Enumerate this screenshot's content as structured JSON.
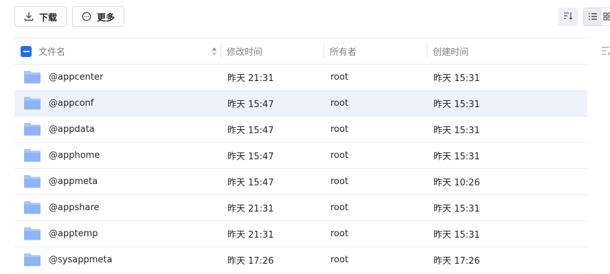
{
  "toolbar": {
    "download_label": "下载",
    "more_label": "更多"
  },
  "table": {
    "columns": {
      "name": "文件名",
      "modified": "修改时间",
      "owner": "所有者",
      "created": "创建时间"
    },
    "rows": [
      {
        "name": "@appcenter",
        "modified": "昨天 21:31",
        "owner": "root",
        "created": "昨天 15:31"
      },
      {
        "name": "@appconf",
        "modified": "昨天 15:47",
        "owner": "root",
        "created": "昨天 15:31"
      },
      {
        "name": "@appdata",
        "modified": "昨天 15:47",
        "owner": "root",
        "created": "昨天 15:31"
      },
      {
        "name": "@apphome",
        "modified": "昨天 15:47",
        "owner": "root",
        "created": "昨天 15:31"
      },
      {
        "name": "@appmeta",
        "modified": "昨天 15:47",
        "owner": "root",
        "created": "昨天 10:26"
      },
      {
        "name": "@appshare",
        "modified": "昨天 21:31",
        "owner": "root",
        "created": "昨天 15:31"
      },
      {
        "name": "@apptemp",
        "modified": "昨天 21:31",
        "owner": "root",
        "created": "昨天 15:31"
      },
      {
        "name": "@sysappmeta",
        "modified": "昨天 17:26",
        "owner": "root",
        "created": "昨天 17:26"
      }
    ],
    "highlighted_row": 1
  },
  "icons": {
    "download": "download-icon",
    "more": "more-circle-icon",
    "sort": "sort-icon",
    "list_view": "list-view-icon",
    "grid_view": "grid-view-icon",
    "folder": "folder-icon",
    "column_settings": "column-settings-icon"
  },
  "colors": {
    "accent": "#1f6fe0",
    "folder": "#8fb4f5",
    "row_highlight": "#eef3fb",
    "header_text": "#7b8088"
  }
}
